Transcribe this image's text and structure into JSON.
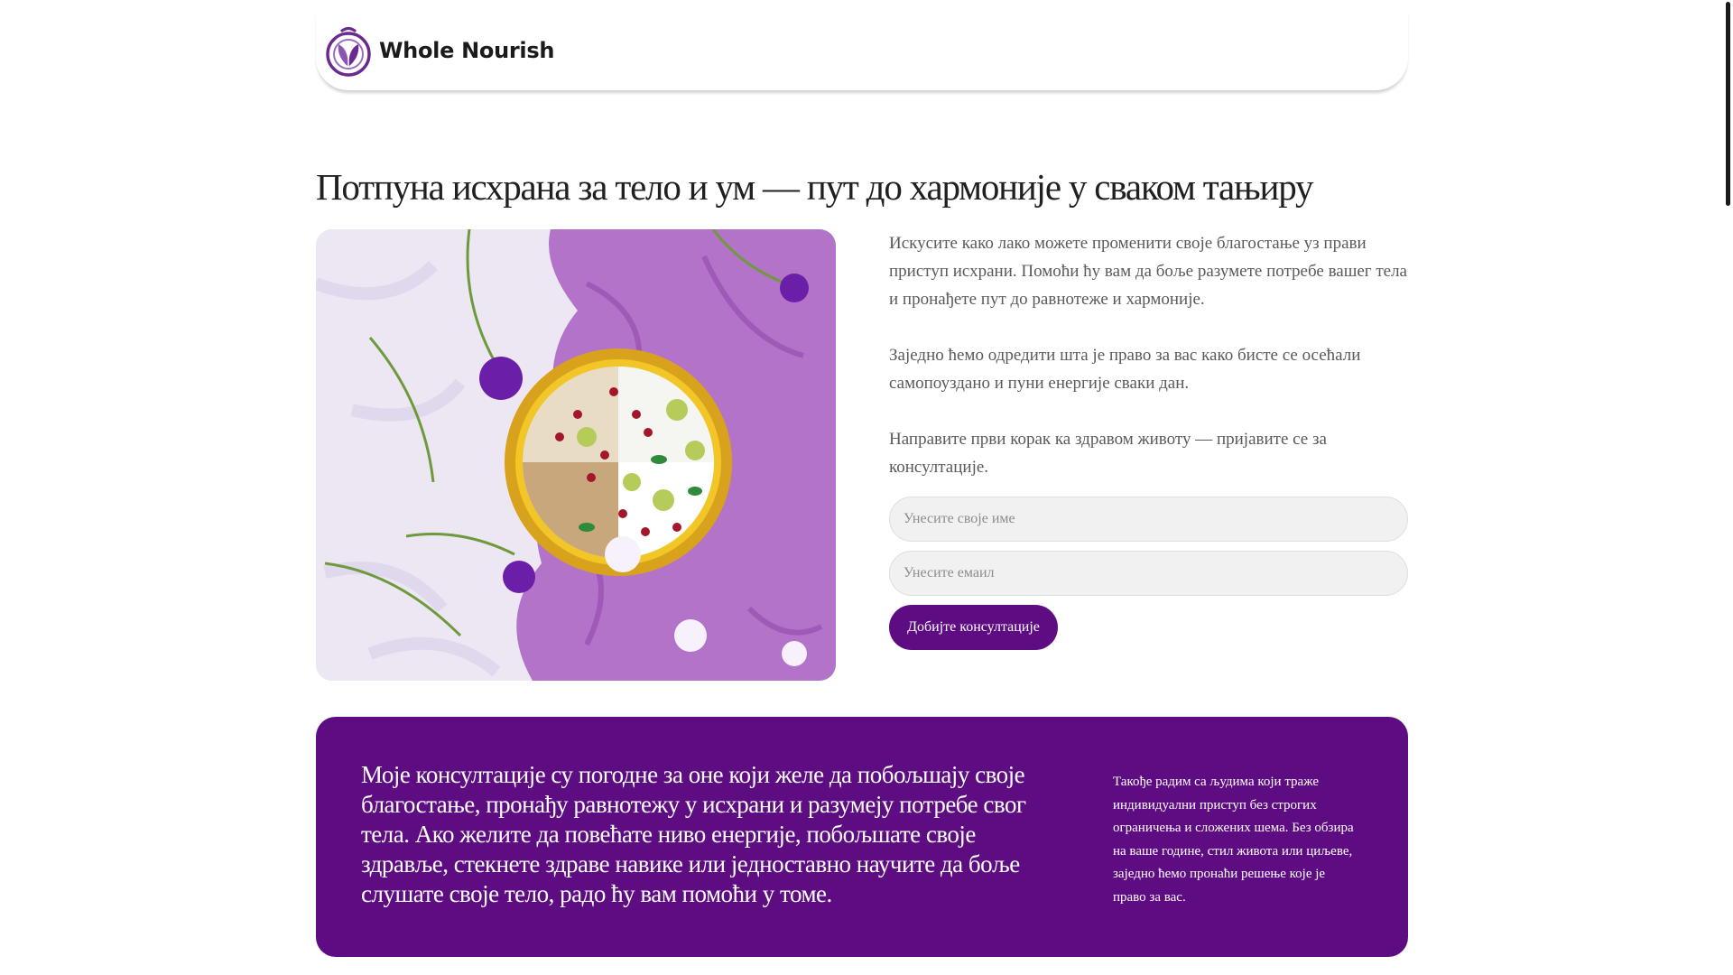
{
  "brand": {
    "name": "Whole Nourish",
    "accent_color": "#5e0c82",
    "logo_icon": "plate-with-leaf-icon"
  },
  "hero": {
    "title": "Потпуна исхрана за тело и ум — пут до хармоније у сваком тањиру",
    "image": "oatmeal-bowl-with-flowers-photo",
    "paragraphs": [
      "Искусите како лако можете променити своје благостање уз прави приступ исхрани. Помоћи ћу вам да боље разумете потребе вашег тела и пронађете пут до равнотеже и хармоније.",
      "Заједно ћемо одредити шта је право за вас како бисте се осећали самопоуздано и пуни енергије сваки дан.",
      "Направите први корак ка здравом животу — пријавите се за консултације."
    ]
  },
  "form": {
    "name_placeholder": "Унесите своје име",
    "email_placeholder": "Унесите емаил",
    "submit_label": "Добијте консултације"
  },
  "banner": {
    "main_text": "Моје консултације су погодне за оне који желе да побољшају своје благостање, пронађу равнотежу у исхрани и разумеју потребе свог тела. Ако желите да повећате ниво енергије, побољшате своје здравље, стекнете здраве навике или једноставно научите да боље слушате своје тело, радо ћу вам помоћи у томе.",
    "side_text": "Такође радим са људима који траже индивидуални приступ без строгих ограничења и сложених шема. Без обзира на ваше године, стил живота или циљеве, заједно ћемо пронаћи решење које је право за вас."
  }
}
